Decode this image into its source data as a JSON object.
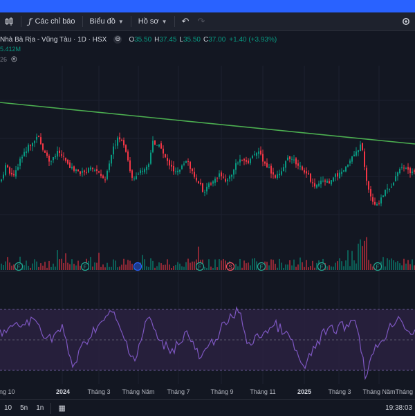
{
  "toolbar": {
    "indicators_label": "Các chỉ báo",
    "chart_label": "Biểu đồ",
    "profile_label": "Hồ sơ"
  },
  "symbol": {
    "name": "Nhà Bà Rịa - Vũng Tàu · 1D · HSX",
    "open_key": "O",
    "open": "35.50",
    "high_key": "H",
    "high": "37.45",
    "low_key": "L",
    "low": "35.50",
    "close_key": "C",
    "close": "37.00",
    "change": "+1.40 (+3.93%)"
  },
  "volume": {
    "value": "5.412M"
  },
  "indicator_row": {
    "value": "26"
  },
  "colors": {
    "up": "#089981",
    "down": "#f23645",
    "trendline": "#4caf50",
    "rsi_line": "#7e57c2",
    "rsi_band": "#2a2140",
    "background": "#131722"
  },
  "events": [
    {
      "label": "F",
      "type": "financial"
    },
    {
      "label": "F",
      "type": "financial"
    },
    {
      "label": "",
      "type": "news"
    },
    {
      "label": "F",
      "type": "financial"
    },
    {
      "label": "S",
      "type": "split"
    },
    {
      "label": "F",
      "type": "financial"
    },
    {
      "label": "F",
      "type": "financial"
    },
    {
      "label": "F",
      "type": "financial"
    }
  ],
  "time_axis": [
    {
      "label": "ng 10",
      "bold": false
    },
    {
      "label": "2024",
      "bold": true
    },
    {
      "label": "Tháng 3",
      "bold": false
    },
    {
      "label": "Tháng Năm",
      "bold": false
    },
    {
      "label": "Tháng 7",
      "bold": false
    },
    {
      "label": "Tháng 9",
      "bold": false
    },
    {
      "label": "Tháng 11",
      "bold": false
    },
    {
      "label": "2025",
      "bold": true
    },
    {
      "label": "Tháng 3",
      "bold": false
    },
    {
      "label": "Tháng Năm",
      "bold": false
    },
    {
      "label": "Tháng",
      "bold": false
    }
  ],
  "bottom": {
    "timeframes": [
      "10",
      "5n",
      "1n"
    ],
    "clock": "19:38:03"
  }
}
